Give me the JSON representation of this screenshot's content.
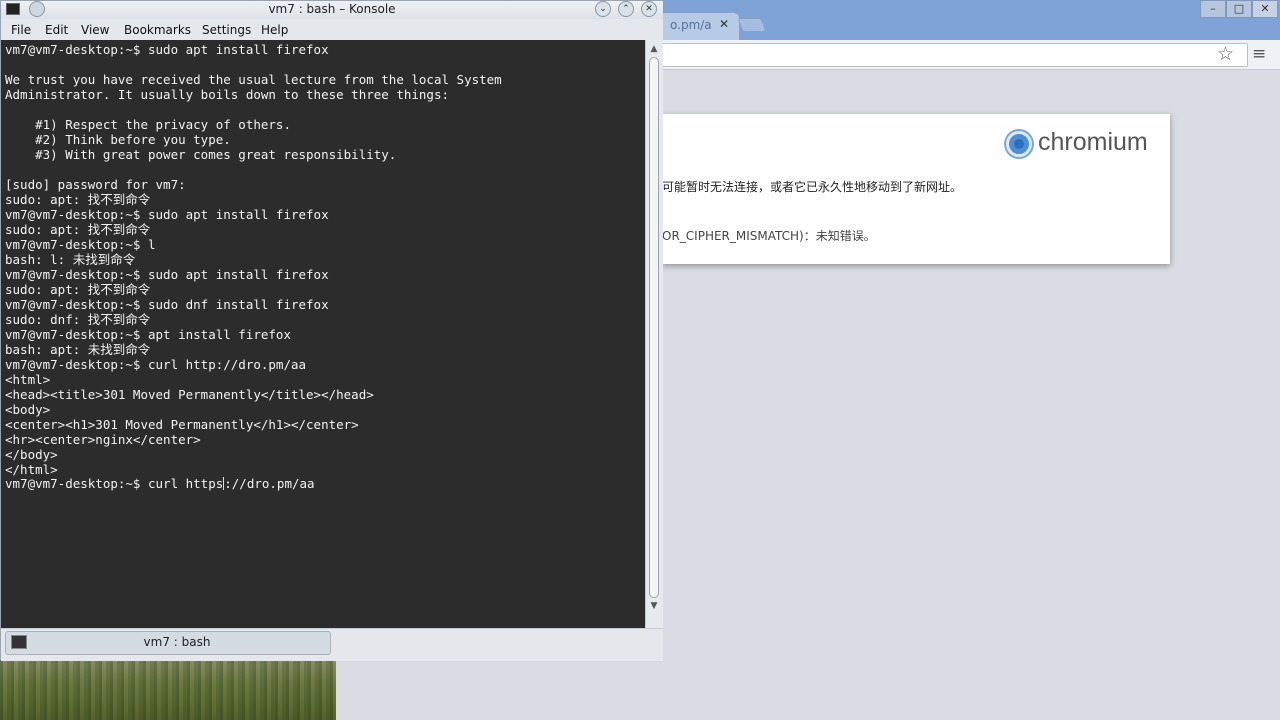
{
  "chromium": {
    "tab_title": "o.pm/a",
    "tab_close": "✕",
    "window_buttons": [
      "–",
      "□",
      "✕"
    ],
    "logo_text": "chromium",
    "error_line1": "可能暂时无法连接，或者它已永久性地移动到了新网址。",
    "error_line2": "OR_CIPHER_MISMATCH)：未知错误。",
    "star_icon": "☆",
    "menu_icon": "≡"
  },
  "konsole": {
    "title": "vm7 : bash – Konsole",
    "window_buttons": [
      "⌄",
      "⌃",
      "✕"
    ],
    "menu": [
      "File",
      "Edit",
      "View",
      "Bookmarks",
      "Settings",
      "Help"
    ],
    "terminal_lines": [
      "vm7@vm7-desktop:~$ sudo apt install firefox",
      "",
      "We trust you have received the usual lecture from the local System",
      "Administrator. It usually boils down to these three things:",
      "",
      "    #1) Respect the privacy of others.",
      "    #2) Think before you type.",
      "    #3) With great power comes great responsibility.",
      "",
      "[sudo] password for vm7:",
      "sudo: apt: 找不到命令",
      "vm7@vm7-desktop:~$ sudo apt install firefox",
      "sudo: apt: 找不到命令",
      "vm7@vm7-desktop:~$ l",
      "bash: l: 未找到命令",
      "vm7@vm7-desktop:~$ sudo apt install firefox",
      "sudo: apt: 找不到命令",
      "vm7@vm7-desktop:~$ sudo dnf install firefox",
      "sudo: dnf: 找不到命令",
      "vm7@vm7-desktop:~$ apt install firefox",
      "bash: apt: 未找到命令",
      "vm7@vm7-desktop:~$ curl http://dro.pm/aa",
      "<html>",
      "<head><title>301 Moved Permanently</title></head>",
      "<body>",
      "<center><h1>301 Moved Permanently</h1></center>",
      "<hr><center>nginx</center>",
      "</body>",
      "</html>"
    ],
    "current_prompt": "vm7@vm7-desktop:~$ curl https",
    "current_after_cursor": "://dro.pm/aa",
    "session_tab_label": "vm7 : bash"
  }
}
